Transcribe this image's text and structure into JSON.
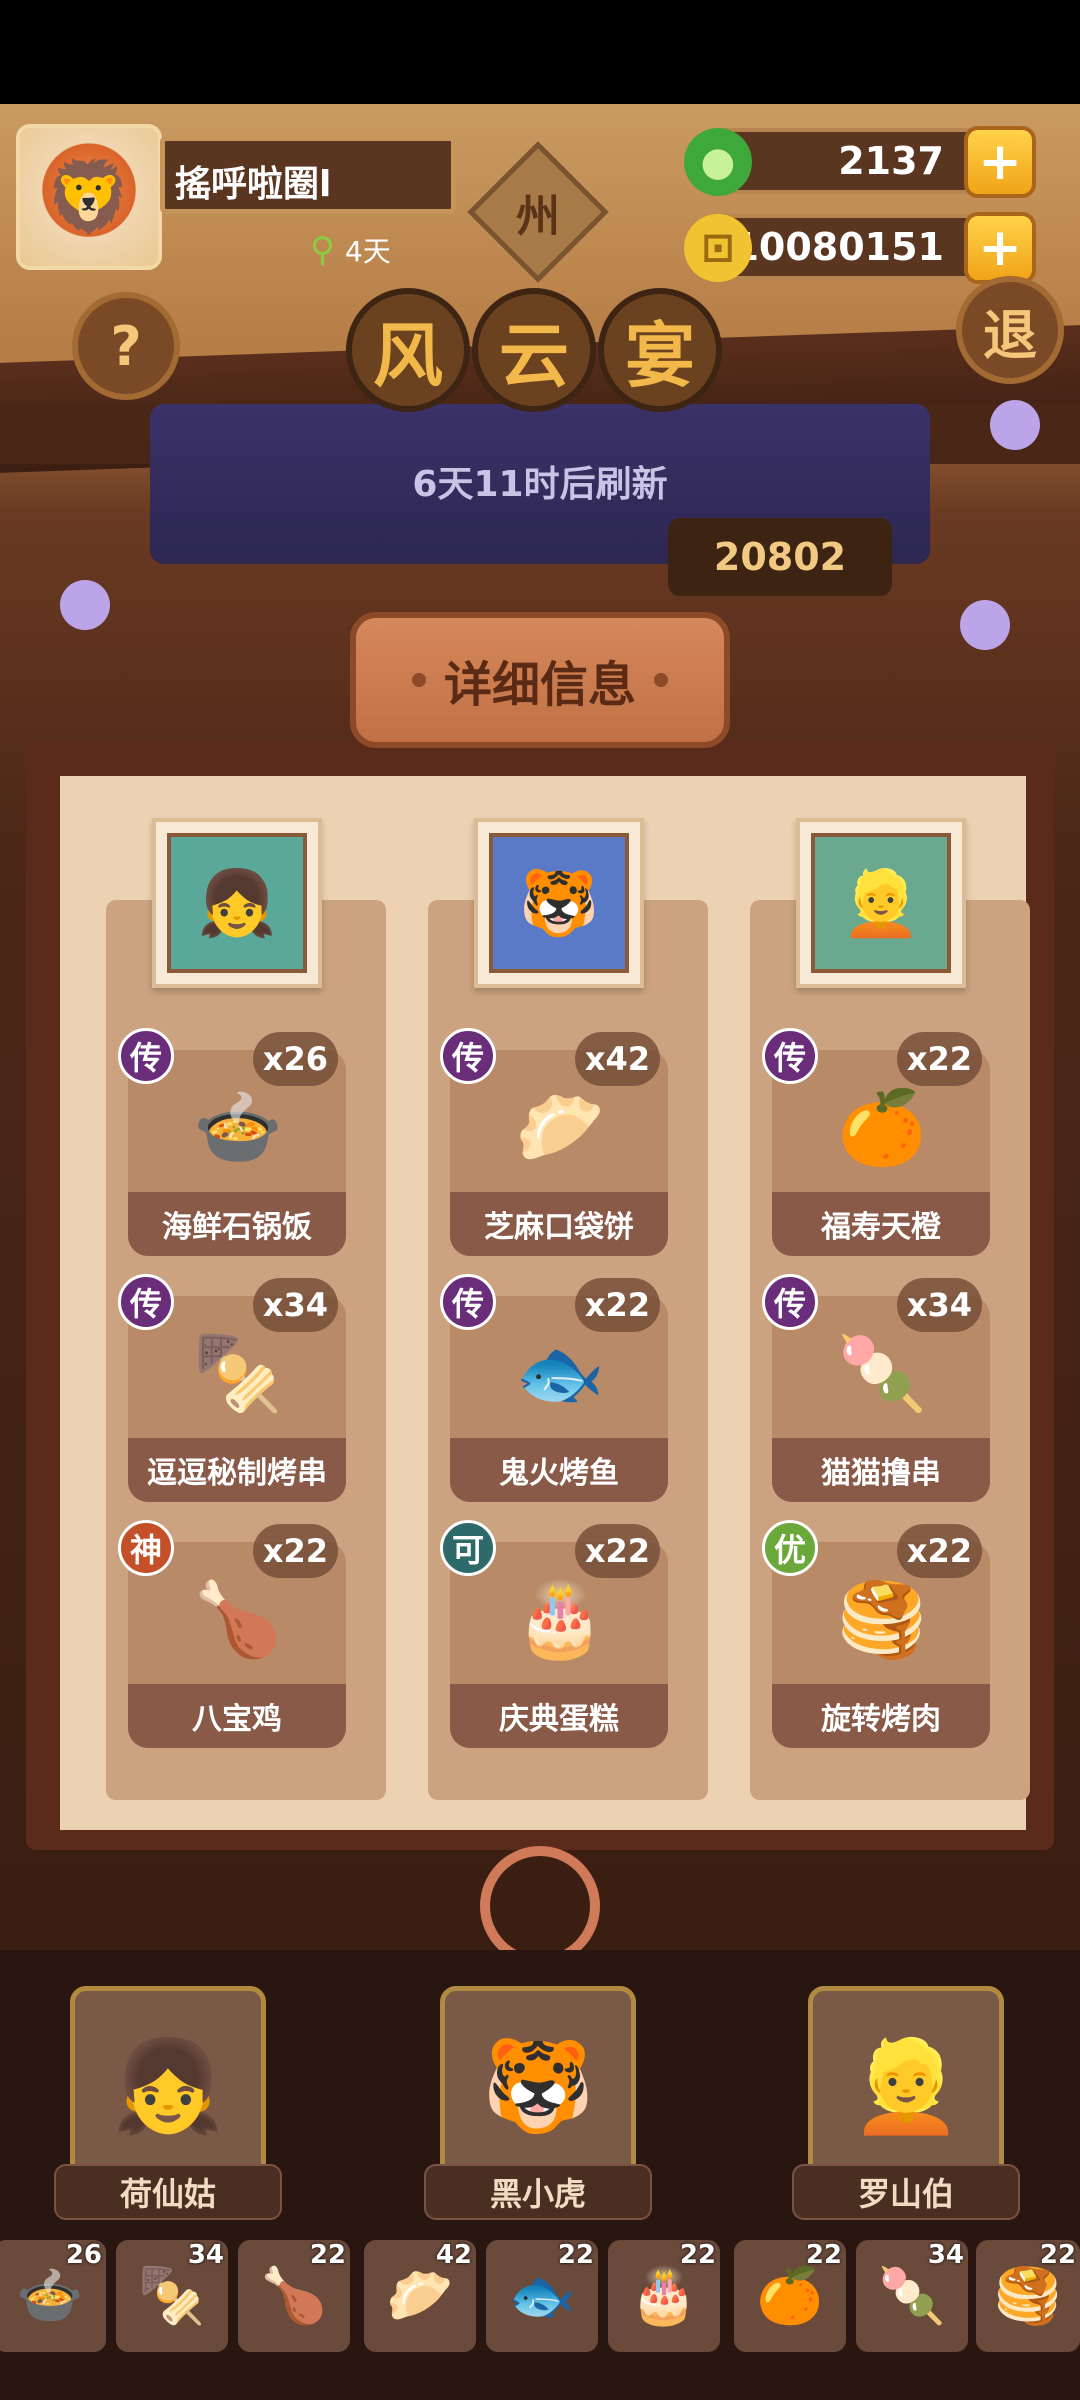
{
  "player": {
    "name": "搖呼啦圈l",
    "days_label": "4天",
    "region": "州"
  },
  "currency": {
    "jade": "2137",
    "coins": "10080151"
  },
  "buttons": {
    "help": "?",
    "exit": "退"
  },
  "event": {
    "title_chars": [
      "风",
      "云",
      "宴"
    ],
    "refresh": "6天11时后刷新",
    "score": "20802"
  },
  "detail_button": "详细信息",
  "columns": [
    {
      "portrait_icon": "fairy-portrait",
      "dishes": [
        {
          "name": "海鲜石锅饭",
          "count": "x26",
          "rank": "传",
          "icon": "🍲"
        },
        {
          "name": "逗逗秘制烤串",
          "count": "x34",
          "rank": "传",
          "icon": "🍢"
        },
        {
          "name": "八宝鸡",
          "count": "x22",
          "rank": "神",
          "icon": "🍗"
        }
      ]
    },
    {
      "portrait_icon": "tiger-portrait",
      "dishes": [
        {
          "name": "芝麻口袋饼",
          "count": "x42",
          "rank": "传",
          "icon": "🥟"
        },
        {
          "name": "鬼火烤鱼",
          "count": "x22",
          "rank": "传",
          "icon": "🐟"
        },
        {
          "name": "庆典蛋糕",
          "count": "x22",
          "rank": "可",
          "icon": "🎂"
        }
      ]
    },
    {
      "portrait_icon": "blond-portrait",
      "dishes": [
        {
          "name": "福寿天橙",
          "count": "x22",
          "rank": "传",
          "icon": "🍊"
        },
        {
          "name": "猫猫撸串",
          "count": "x34",
          "rank": "传",
          "icon": "🍡"
        },
        {
          "name": "旋转烤肉",
          "count": "x22",
          "rank": "优",
          "icon": "🥞"
        }
      ]
    }
  ],
  "heroes": [
    {
      "name": "荷仙姑",
      "icon": "👧"
    },
    {
      "name": "黑小虎",
      "icon": "🐯"
    },
    {
      "name": "罗山伯",
      "icon": "👱"
    }
  ],
  "strip": [
    {
      "count": "26",
      "icon": "🍲"
    },
    {
      "count": "34",
      "icon": "🍢"
    },
    {
      "count": "22",
      "icon": "🍗"
    },
    {
      "count": "42",
      "icon": "🥟"
    },
    {
      "count": "22",
      "icon": "🐟"
    },
    {
      "count": "22",
      "icon": "🎂"
    },
    {
      "count": "22",
      "icon": "🍊"
    },
    {
      "count": "34",
      "icon": "🍡"
    },
    {
      "count": "22",
      "icon": "🥞"
    }
  ],
  "colors": {
    "rank_传": "#6a2d7a",
    "rank_神": "#c4502a",
    "rank_可": "#2f6a6a",
    "rank_优": "#6aa83a"
  }
}
